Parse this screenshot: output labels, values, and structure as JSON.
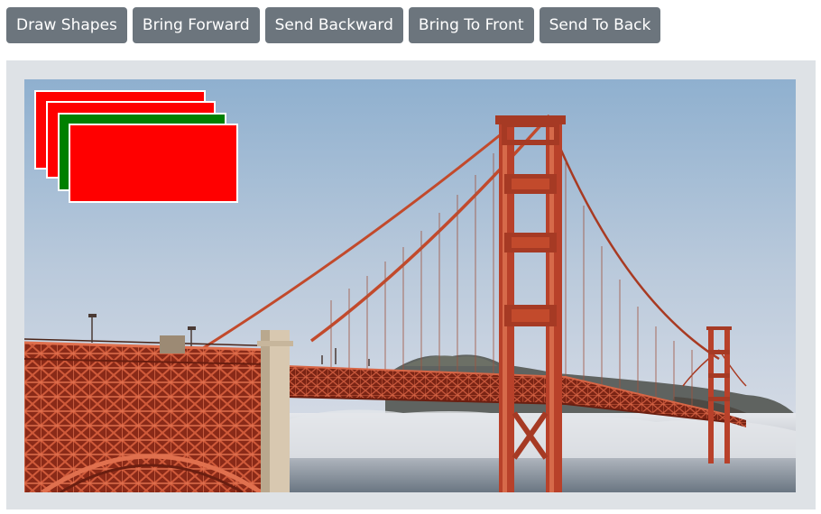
{
  "toolbar": {
    "buttons": [
      {
        "label": "Draw Shapes"
      },
      {
        "label": "Bring Forward"
      },
      {
        "label": "Send Backward"
      },
      {
        "label": "Bring To Front"
      },
      {
        "label": "Send To Back"
      }
    ]
  },
  "canvas": {
    "photo": "Golden Gate Bridge",
    "shapes": [
      {
        "color": "#ff0000"
      },
      {
        "color": "#ff0000"
      },
      {
        "color": "#008000"
      },
      {
        "color": "#ff0000"
      }
    ]
  },
  "colors": {
    "button_bg": "#6c757d",
    "button_text": "#ffffff",
    "panel_bg": "#dee2e6",
    "shape_border": "#ffffff"
  }
}
